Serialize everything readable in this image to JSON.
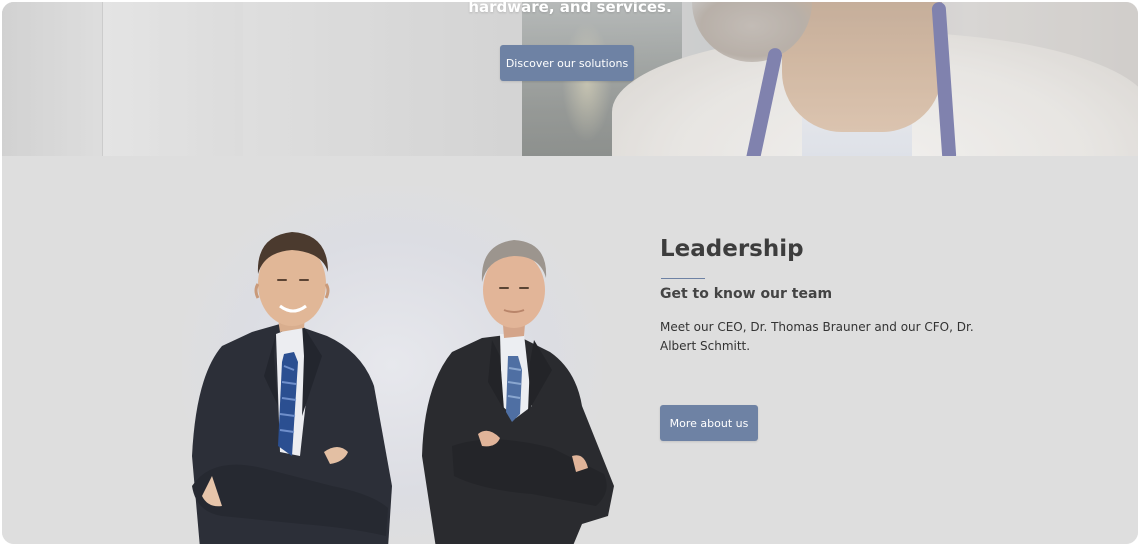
{
  "hero": {
    "headline": "hardware, and services.",
    "cta_label": "Discover our solutions"
  },
  "leadership": {
    "heading": "Leadership",
    "subheading": "Get to know our team",
    "body": "Meet our CEO, Dr. Thomas Brauner and our CFO, Dr. Albert Schmitt.",
    "cta_label": "More about us"
  },
  "colors": {
    "accent": "#6e82a4",
    "section_bg": "#dedede",
    "heading": "#3d3d3d"
  }
}
